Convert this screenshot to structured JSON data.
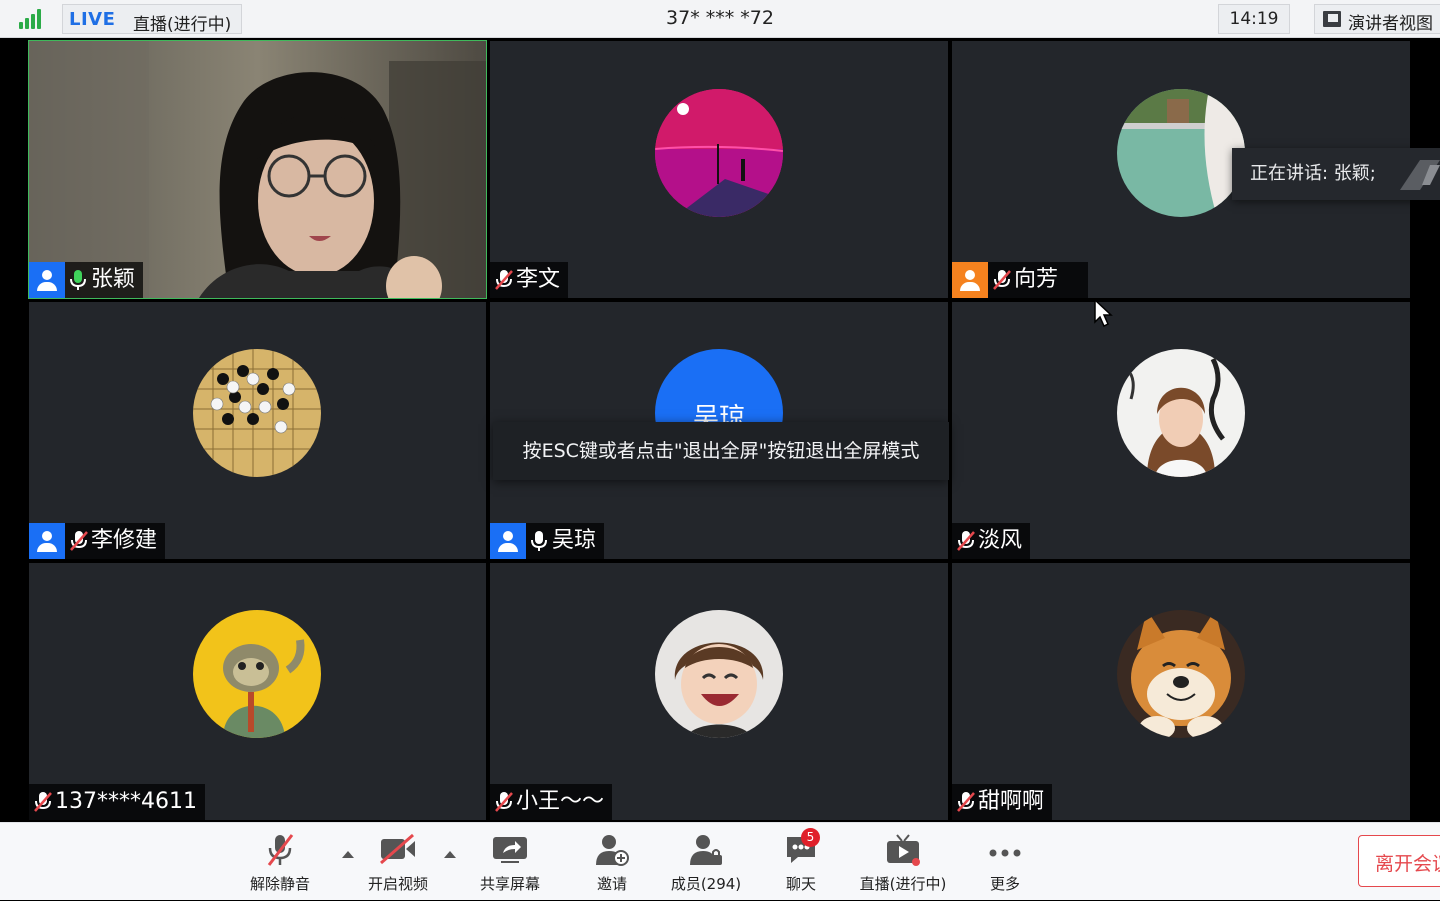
{
  "topbar": {
    "live_label": "LIVE",
    "live_status": "直播(进行中)",
    "meeting_id": "37* *** *72",
    "clock": "14:19",
    "view_button": "演讲者视图"
  },
  "participants": [
    {
      "name": "张颖",
      "mic": "on",
      "role": "host",
      "active": true
    },
    {
      "name": "李文",
      "mic": "muted"
    },
    {
      "name": "向芳",
      "mic": "muted",
      "role": "cohost"
    },
    {
      "name": "李修建",
      "mic": "muted",
      "role": "host"
    },
    {
      "name": "吴琼",
      "mic": "on",
      "role": "host",
      "avatar_text": "吴琼"
    },
    {
      "name": "淡风",
      "mic": "muted"
    },
    {
      "name": "137****4611",
      "mic": "muted"
    },
    {
      "name": "小王～～",
      "mic": "muted"
    },
    {
      "name": "甜啊啊",
      "mic": "muted"
    }
  ],
  "overlays": {
    "speaking": "正在讲话: 张颖;",
    "esc_hint": "按ESC键或者点击\"退出全屏\"按钮退出全屏模式"
  },
  "toolbar": {
    "unmute": "解除静音",
    "start_video": "开启视频",
    "share_screen": "共享屏幕",
    "invite": "邀请",
    "members": "成员(294)",
    "chat": "聊天",
    "chat_badge": "5",
    "live": "直播(进行中)",
    "more": "更多",
    "leave": "离开会议"
  },
  "colors": {
    "accent_blue": "#1a6ff5",
    "speaker_green": "#3fb95b",
    "tile_bg": "#23262b",
    "leave_red": "#e5484d"
  }
}
